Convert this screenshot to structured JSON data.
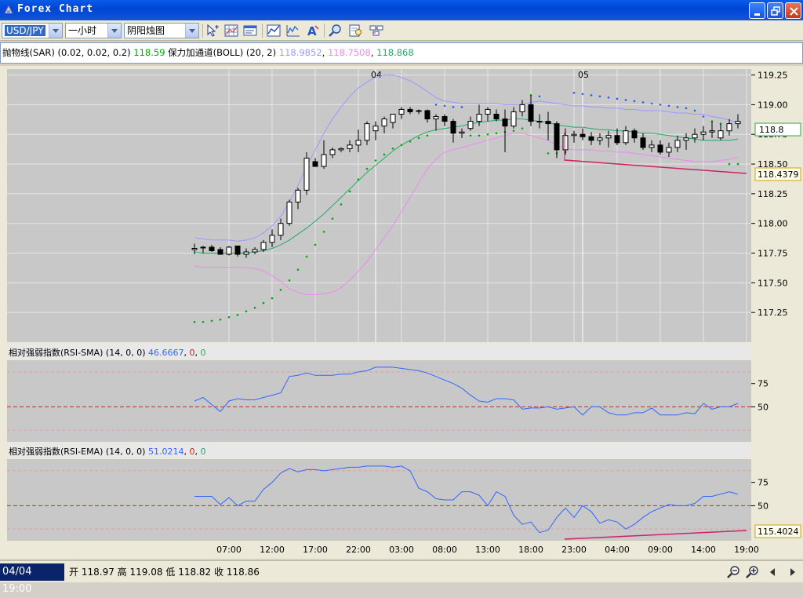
{
  "window": {
    "title": "Forex Chart"
  },
  "toolbar": {
    "symbol": "USD/JPY",
    "period": "一小时",
    "chart_type": "阴阳烛图"
  },
  "info": {
    "sar_label": "抛物线(SAR) (0.02, 0.02, 0.2)",
    "sar_value": "118.59",
    "boll_label": "保力加通道(BOLL) (20, 2)",
    "boll_upper": "118.9852",
    "boll_lower": "118.7508",
    "boll_mid": "118.868"
  },
  "rsi_sma": {
    "label": "相对强弱指数(RSI-SMA) (14, 0, 0)",
    "value": "46.6667",
    "v2": "0",
    "v3": "0"
  },
  "rsi_ema": {
    "label": "相对强弱指数(RSI-EMA) (14, 0, 0)",
    "value": "51.0214",
    "v2": "0",
    "v3": "0"
  },
  "price_labels": {
    "current": "118.8",
    "line_end": "118.4379",
    "rsi_line_end": "115.4024"
  },
  "status": {
    "datetime": "04/04 19:00",
    "open_label": "开",
    "open": "118.97",
    "high_label": "高",
    "high": "119.08",
    "low_label": "低",
    "low": "118.82",
    "close_label": "收",
    "close": "118.86"
  },
  "colors": {
    "up": "#ffffff",
    "down": "#000000",
    "sar_up": "#00aa00",
    "sar_down": "#1f5fff",
    "boll_upper": "#9a9aff",
    "boll_mid": "#22aa66",
    "boll_lower": "#ee88ee",
    "rsi": "#3366ff",
    "level": "#dd2222",
    "trend": "#cc2266"
  },
  "chart_data": {
    "type": "candlestick",
    "day_labels": [
      {
        "text": "04",
        "at": "04/04 00:00"
      },
      {
        "text": "05",
        "at": "04/05 00:00"
      }
    ],
    "x_ticks": [
      "07:00",
      "12:00",
      "17:00",
      "22:00",
      "03:00",
      "08:00",
      "13:00",
      "18:00",
      "23:00",
      "04:00",
      "09:00",
      "14:00",
      "19:00"
    ],
    "y_ticks": [
      "119.25",
      "119.00",
      "118.75",
      "118.50",
      "118.25",
      "118.00",
      "117.75",
      "117.50",
      "117.25"
    ],
    "ylim": [
      117.0,
      119.3
    ],
    "rsi_sma_ticks": [
      "75",
      "50"
    ],
    "rsi_ema_ticks": [
      "75",
      "50"
    ],
    "candles": [
      [
        117.78,
        117.83,
        117.74,
        117.79
      ],
      [
        117.8,
        117.81,
        117.75,
        117.8
      ],
      [
        117.8,
        117.82,
        117.76,
        117.77
      ],
      [
        117.78,
        117.8,
        117.74,
        117.74
      ],
      [
        117.74,
        117.81,
        117.73,
        117.8
      ],
      [
        117.81,
        117.81,
        117.72,
        117.74
      ],
      [
        117.74,
        117.79,
        117.71,
        117.76
      ],
      [
        117.76,
        117.8,
        117.74,
        117.78
      ],
      [
        117.78,
        117.86,
        117.76,
        117.84
      ],
      [
        117.84,
        117.95,
        117.8,
        117.9
      ],
      [
        117.9,
        118.04,
        117.86,
        118.0
      ],
      [
        118.0,
        118.2,
        117.98,
        118.18
      ],
      [
        118.18,
        118.3,
        118.12,
        118.28
      ],
      [
        118.28,
        118.6,
        118.24,
        118.55
      ],
      [
        118.52,
        118.55,
        118.48,
        118.48
      ],
      [
        118.48,
        118.7,
        118.46,
        118.58
      ],
      [
        118.58,
        118.64,
        118.55,
        118.62
      ],
      [
        118.62,
        118.64,
        118.6,
        118.63
      ],
      [
        118.63,
        118.7,
        118.6,
        118.66
      ],
      [
        118.66,
        118.79,
        118.6,
        118.7
      ],
      [
        118.7,
        118.86,
        118.66,
        118.84
      ],
      [
        118.78,
        118.86,
        118.7,
        118.82
      ],
      [
        118.82,
        118.9,
        118.76,
        118.88
      ],
      [
        118.85,
        118.92,
        118.8,
        118.92
      ],
      [
        118.92,
        118.98,
        118.88,
        118.96
      ],
      [
        118.96,
        118.98,
        118.92,
        118.94
      ],
      [
        118.95,
        118.96,
        118.92,
        118.95
      ],
      [
        118.95,
        118.96,
        118.85,
        118.88
      ],
      [
        118.88,
        118.92,
        118.78,
        118.9
      ],
      [
        118.9,
        118.92,
        118.82,
        118.86
      ],
      [
        118.86,
        118.88,
        118.68,
        118.76
      ],
      [
        118.76,
        118.8,
        118.72,
        118.77
      ],
      [
        118.8,
        118.9,
        118.78,
        118.86
      ],
      [
        118.86,
        119.0,
        118.82,
        118.92
      ],
      [
        118.92,
        118.98,
        118.86,
        118.96
      ],
      [
        118.92,
        118.96,
        118.86,
        118.88
      ],
      [
        118.88,
        118.96,
        118.6,
        118.82
      ],
      [
        118.82,
        118.98,
        118.8,
        118.94
      ],
      [
        118.94,
        119.04,
        118.9,
        119.0
      ],
      [
        119.0,
        119.08,
        118.82,
        118.86
      ],
      [
        118.86,
        118.92,
        118.8,
        118.86
      ],
      [
        118.86,
        118.94,
        118.7,
        118.84
      ],
      [
        118.84,
        118.86,
        118.55,
        118.62
      ],
      [
        118.62,
        118.8,
        118.58,
        118.74
      ],
      [
        118.74,
        118.78,
        118.68,
        118.75
      ],
      [
        118.75,
        118.8,
        118.7,
        118.73
      ],
      [
        118.73,
        118.77,
        118.66,
        118.7
      ],
      [
        118.7,
        118.76,
        118.66,
        118.72
      ],
      [
        118.72,
        118.78,
        118.64,
        118.74
      ],
      [
        118.74,
        118.8,
        118.66,
        118.68
      ],
      [
        118.68,
        118.82,
        118.66,
        118.78
      ],
      [
        118.78,
        118.8,
        118.68,
        118.72
      ],
      [
        118.72,
        118.76,
        118.62,
        118.64
      ],
      [
        118.64,
        118.7,
        118.6,
        118.66
      ],
      [
        118.66,
        118.7,
        118.58,
        118.6
      ],
      [
        118.6,
        118.68,
        118.56,
        118.64
      ],
      [
        118.64,
        118.74,
        118.6,
        118.7
      ],
      [
        118.7,
        118.76,
        118.62,
        118.72
      ],
      [
        118.72,
        118.8,
        118.68,
        118.75
      ],
      [
        118.75,
        118.82,
        118.7,
        118.77
      ],
      [
        118.77,
        118.86,
        118.72,
        118.78
      ],
      [
        118.72,
        118.84,
        118.7,
        118.78
      ],
      [
        118.78,
        118.88,
        118.74,
        118.84
      ],
      [
        118.84,
        118.92,
        118.8,
        118.86
      ]
    ],
    "sar": [
      117.17,
      117.17,
      117.18,
      117.19,
      117.21,
      117.23,
      117.26,
      117.29,
      117.33,
      117.37,
      117.44,
      117.52,
      117.61,
      117.72,
      117.82,
      117.93,
      118.04,
      118.16,
      118.27,
      118.37,
      118.46,
      118.53,
      118.58,
      118.63,
      118.66,
      118.69,
      118.72,
      118.74,
      119.0,
      118.99,
      118.98,
      118.98,
      118.74,
      118.74,
      118.75,
      118.76,
      118.77,
      118.78,
      118.8,
      119.08,
      119.07,
      118.59,
      118.59,
      118.6,
      119.1,
      119.09,
      119.08,
      119.07,
      119.06,
      119.05,
      119.04,
      119.03,
      119.02,
      119.01,
      119.0,
      118.99,
      118.98,
      118.97,
      118.95,
      118.9,
      118.86,
      118.84,
      118.5,
      118.5
    ],
    "boll_upper": [
      117.88,
      117.87,
      117.86,
      117.86,
      117.86,
      117.85,
      117.86,
      117.88,
      117.92,
      117.98,
      118.06,
      118.18,
      118.32,
      118.48,
      118.62,
      118.76,
      118.88,
      118.98,
      119.07,
      119.14,
      119.19,
      119.23,
      119.25,
      119.25,
      119.23,
      119.2,
      119.16,
      119.11,
      119.06,
      119.03,
      119.02,
      119.01,
      119.01,
      119.01,
      119.01,
      119.01,
      119.0,
      119.0,
      119.0,
      119.02,
      119.03,
      119.02,
      119.01,
      119.0,
      118.99,
      118.99,
      118.98,
      118.98,
      118.97,
      118.97,
      118.96,
      118.96,
      118.95,
      118.95,
      118.95,
      118.94,
      118.93,
      118.93,
      118.92,
      118.92,
      118.9,
      118.89,
      118.87,
      118.85
    ],
    "boll_mid": [
      117.76,
      117.75,
      117.75,
      117.75,
      117.75,
      117.75,
      117.75,
      117.76,
      117.77,
      117.79,
      117.82,
      117.86,
      117.91,
      117.96,
      118.02,
      118.08,
      118.15,
      118.22,
      118.29,
      118.36,
      118.43,
      118.49,
      118.55,
      118.61,
      118.66,
      118.7,
      118.74,
      118.77,
      118.79,
      118.8,
      118.81,
      118.82,
      118.84,
      118.85,
      118.86,
      118.87,
      118.87,
      118.88,
      118.88,
      118.87,
      118.86,
      118.85,
      118.83,
      118.82,
      118.81,
      118.81,
      118.8,
      118.79,
      118.79,
      118.78,
      118.78,
      118.77,
      118.76,
      118.76,
      118.75,
      118.74,
      118.73,
      118.72,
      118.71,
      118.7,
      118.7,
      118.7,
      118.7,
      118.71
    ],
    "boll_lower": [
      117.64,
      117.63,
      117.63,
      117.63,
      117.63,
      117.63,
      117.63,
      117.62,
      117.6,
      117.56,
      117.51,
      117.45,
      117.42,
      117.4,
      117.4,
      117.41,
      117.42,
      117.46,
      117.52,
      117.6,
      117.68,
      117.78,
      117.88,
      117.98,
      118.1,
      118.22,
      118.34,
      118.46,
      118.54,
      118.6,
      118.62,
      118.64,
      118.66,
      118.68,
      118.7,
      118.72,
      118.74,
      118.76,
      118.76,
      118.74,
      118.72,
      118.7,
      118.66,
      118.63,
      118.62,
      118.62,
      118.62,
      118.61,
      118.61,
      118.6,
      118.6,
      118.59,
      118.58,
      118.57,
      118.56,
      118.55,
      118.54,
      118.53,
      118.52,
      118.52,
      118.52,
      118.53,
      118.54,
      118.56
    ],
    "rsi_sma": [
      55,
      58,
      52,
      46,
      55,
      57,
      56,
      56,
      58,
      60,
      62,
      76,
      77,
      79,
      77,
      77,
      77,
      78,
      78,
      80,
      81,
      84,
      84,
      84,
      83,
      82,
      81,
      79,
      76,
      73,
      70,
      66,
      60,
      55,
      54,
      57,
      57,
      56,
      48,
      49,
      49,
      50,
      48,
      49,
      50,
      43,
      50,
      50,
      45,
      43,
      43,
      45,
      45,
      49,
      43,
      43,
      43,
      45,
      44,
      53,
      48,
      50,
      50,
      53
    ],
    "rsi_ema": [
      58,
      58,
      58,
      51,
      57,
      50,
      54,
      54,
      64,
      70,
      78,
      82,
      79,
      81,
      81,
      80,
      81,
      82,
      83,
      83,
      84,
      84,
      84,
      83,
      84,
      80,
      65,
      62,
      56,
      55,
      55,
      62,
      62,
      59,
      50,
      62,
      58,
      42,
      34,
      36,
      27,
      29,
      40,
      48,
      40,
      50,
      45,
      35,
      38,
      36,
      30,
      34,
      40,
      45,
      48,
      51,
      50,
      50,
      52,
      58,
      58,
      60,
      62,
      60
    ]
  }
}
